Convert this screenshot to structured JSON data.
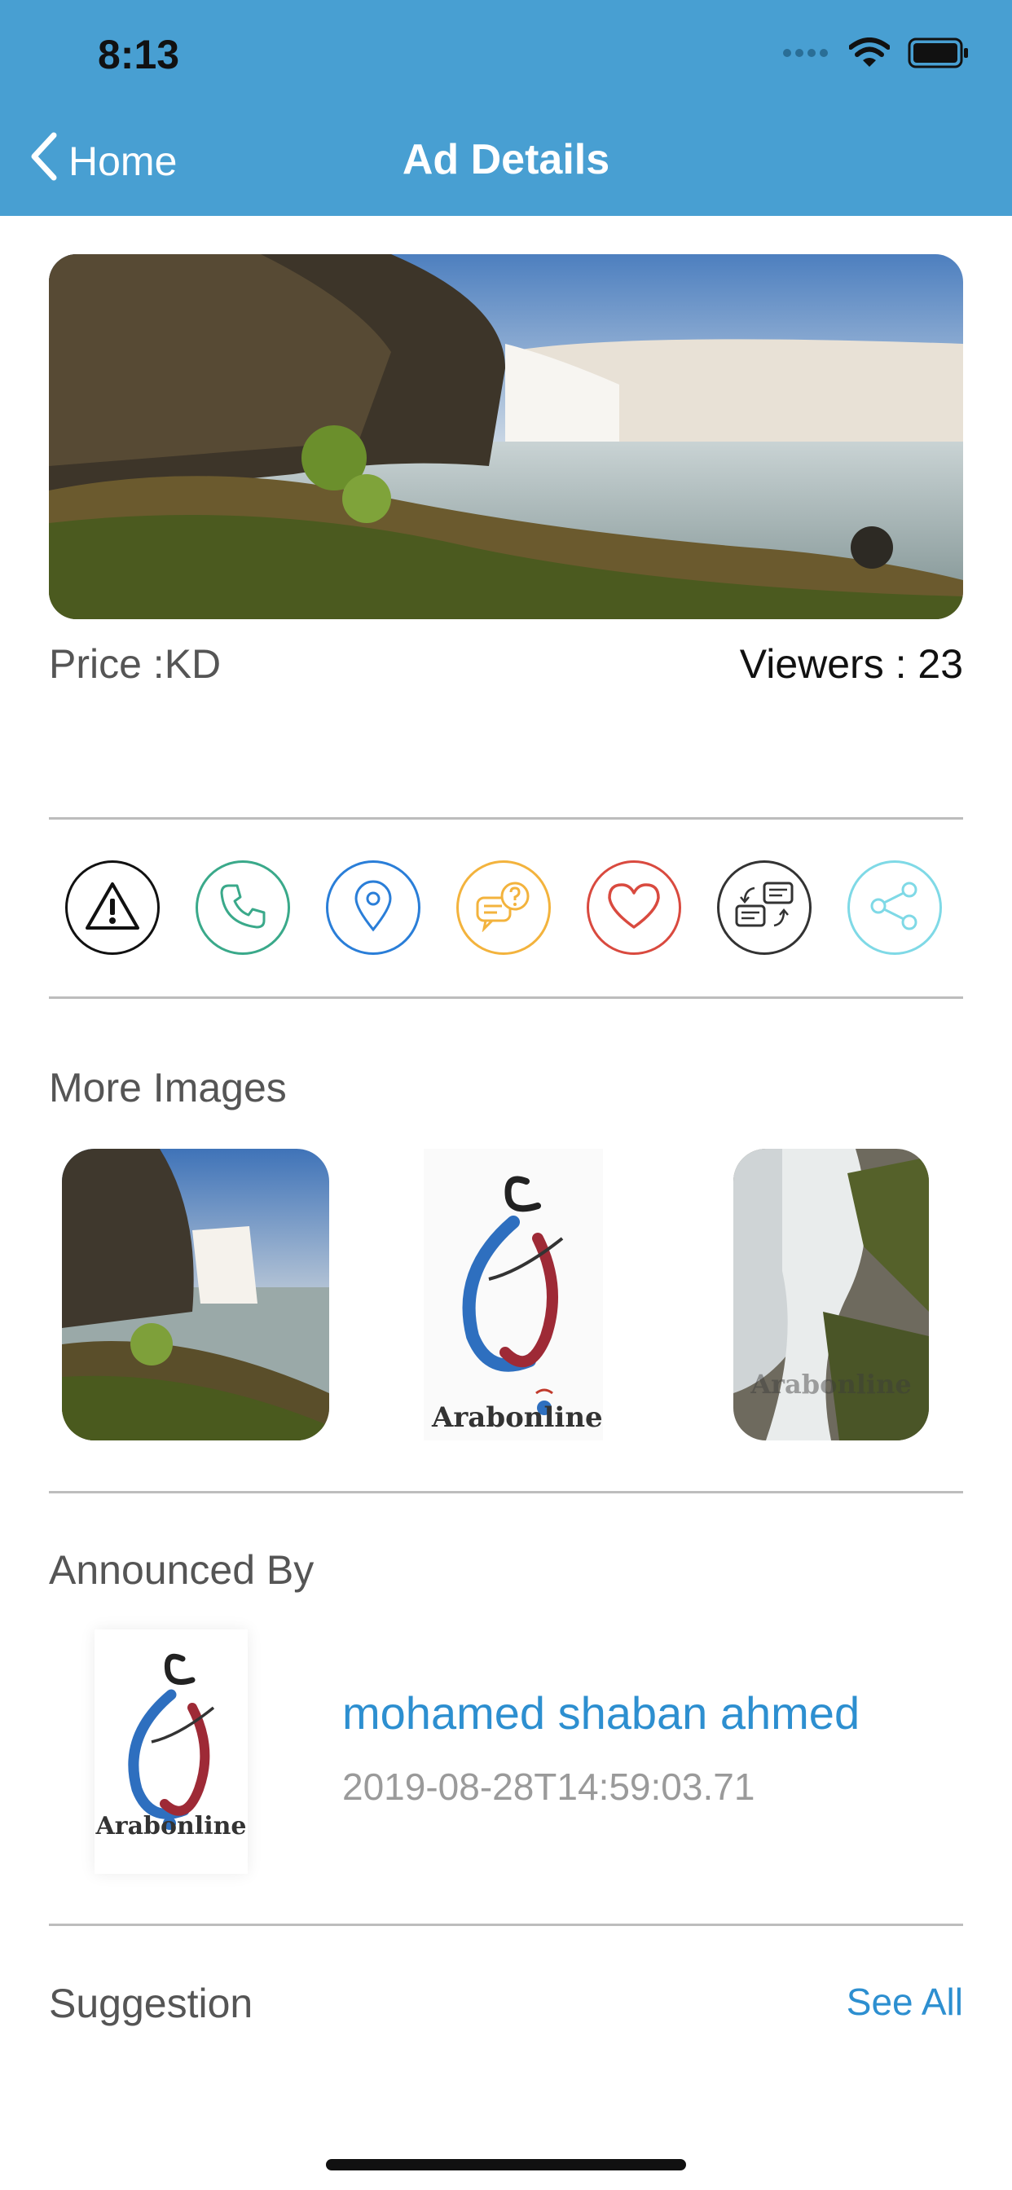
{
  "status_bar": {
    "time": "8:13"
  },
  "nav": {
    "back_label": "Home",
    "title": "Ad Details"
  },
  "ad": {
    "price": "Price :KD",
    "viewers": "Viewers : 23"
  },
  "actions": [
    {
      "name": "report",
      "icon": "warning-icon",
      "color": "#111111"
    },
    {
      "name": "call",
      "icon": "phone-icon",
      "color": "#3aa98a"
    },
    {
      "name": "location",
      "icon": "location-pin-icon",
      "color": "#2a7ed8"
    },
    {
      "name": "inquiry",
      "icon": "question-chat-icon",
      "color": "#f3b33d"
    },
    {
      "name": "favorite",
      "icon": "heart-icon",
      "color": "#d94a3f"
    },
    {
      "name": "messages",
      "icon": "chat-exchange-icon",
      "color": "#333333"
    },
    {
      "name": "share",
      "icon": "share-icon",
      "color": "#7fd9e6"
    }
  ],
  "more_images": {
    "title": "More Images",
    "logo_text": "Arabonline"
  },
  "announced_by": {
    "title": "Announced By",
    "name": "mohamed shaban ahmed",
    "date": "2019-08-28T14:59:03.71",
    "logo_text": "Arabonline"
  },
  "suggestion": {
    "title": "Suggestion",
    "see_all": "See All"
  }
}
